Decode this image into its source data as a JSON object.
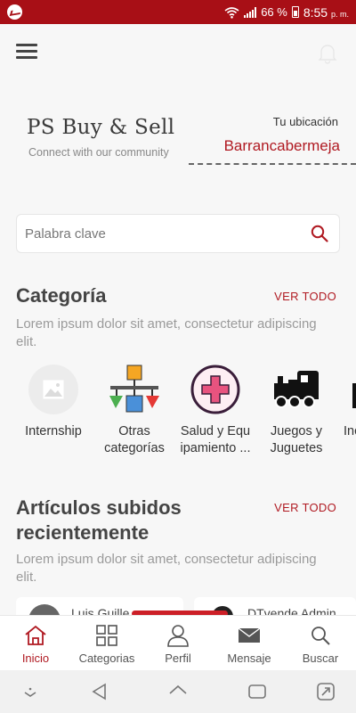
{
  "status_bar": {
    "battery": "66 %",
    "time": "8:55",
    "ampm": "p. m."
  },
  "header": {
    "brand_title": "PS Buy & Sell",
    "brand_subtitle": "Connect with our community",
    "location_label": "Tu ubicación",
    "location_value": "Barrancabermeja"
  },
  "search": {
    "placeholder": "Palabra clave"
  },
  "categories_section": {
    "title": "Categoría",
    "view_all": "VER TODO",
    "description": "Lorem ipsum dolor sit amet, consectetur adipiscing elit.",
    "items": [
      {
        "label": "Internship",
        "icon": "image-placeholder-icon"
      },
      {
        "label": "Otras categorías",
        "icon": "hierarchy-icon"
      },
      {
        "label": "Salud y Equipamiento ...",
        "icon": "medical-cross-icon"
      },
      {
        "label": "Juegos y Juguetes",
        "icon": "toy-train-icon"
      },
      {
        "label": "Inc",
        "icon": "category-icon"
      }
    ]
  },
  "recent_section": {
    "title": "Artículos subidos recientemente",
    "view_all": "VER TODO",
    "description": "Lorem ipsum dolor sit amet, consectetur adipiscing elit.",
    "cards": [
      {
        "user": "Luis Guille"
      },
      {
        "user": "DTvende Admin"
      }
    ]
  },
  "bottom_nav": {
    "items": [
      {
        "label": "Inicio",
        "icon": "home-icon",
        "active": true
      },
      {
        "label": "Categorias",
        "icon": "grid-icon",
        "active": false
      },
      {
        "label": "Perfil",
        "icon": "profile-icon",
        "active": false
      },
      {
        "label": "Mensaje",
        "icon": "mail-icon",
        "active": false
      },
      {
        "label": "Buscar",
        "icon": "search-icon",
        "active": false
      }
    ]
  },
  "colors": {
    "accent": "#b01a22",
    "status_bar": "#a80f16"
  }
}
